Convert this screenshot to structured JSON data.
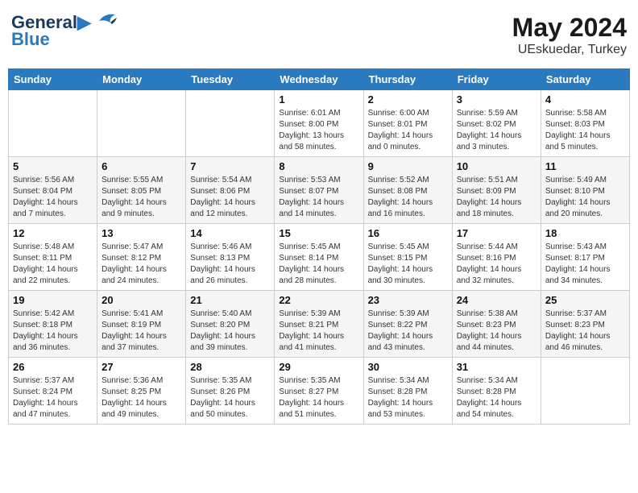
{
  "header": {
    "logo_line1": "General",
    "logo_line2": "Blue",
    "month": "May 2024",
    "location": "UEskuedar, Turkey"
  },
  "weekdays": [
    "Sunday",
    "Monday",
    "Tuesday",
    "Wednesday",
    "Thursday",
    "Friday",
    "Saturday"
  ],
  "weeks": [
    [
      {
        "day": "",
        "info": ""
      },
      {
        "day": "",
        "info": ""
      },
      {
        "day": "",
        "info": ""
      },
      {
        "day": "1",
        "info": "Sunrise: 6:01 AM\nSunset: 8:00 PM\nDaylight: 13 hours\nand 58 minutes."
      },
      {
        "day": "2",
        "info": "Sunrise: 6:00 AM\nSunset: 8:01 PM\nDaylight: 14 hours\nand 0 minutes."
      },
      {
        "day": "3",
        "info": "Sunrise: 5:59 AM\nSunset: 8:02 PM\nDaylight: 14 hours\nand 3 minutes."
      },
      {
        "day": "4",
        "info": "Sunrise: 5:58 AM\nSunset: 8:03 PM\nDaylight: 14 hours\nand 5 minutes."
      }
    ],
    [
      {
        "day": "5",
        "info": "Sunrise: 5:56 AM\nSunset: 8:04 PM\nDaylight: 14 hours\nand 7 minutes."
      },
      {
        "day": "6",
        "info": "Sunrise: 5:55 AM\nSunset: 8:05 PM\nDaylight: 14 hours\nand 9 minutes."
      },
      {
        "day": "7",
        "info": "Sunrise: 5:54 AM\nSunset: 8:06 PM\nDaylight: 14 hours\nand 12 minutes."
      },
      {
        "day": "8",
        "info": "Sunrise: 5:53 AM\nSunset: 8:07 PM\nDaylight: 14 hours\nand 14 minutes."
      },
      {
        "day": "9",
        "info": "Sunrise: 5:52 AM\nSunset: 8:08 PM\nDaylight: 14 hours\nand 16 minutes."
      },
      {
        "day": "10",
        "info": "Sunrise: 5:51 AM\nSunset: 8:09 PM\nDaylight: 14 hours\nand 18 minutes."
      },
      {
        "day": "11",
        "info": "Sunrise: 5:49 AM\nSunset: 8:10 PM\nDaylight: 14 hours\nand 20 minutes."
      }
    ],
    [
      {
        "day": "12",
        "info": "Sunrise: 5:48 AM\nSunset: 8:11 PM\nDaylight: 14 hours\nand 22 minutes."
      },
      {
        "day": "13",
        "info": "Sunrise: 5:47 AM\nSunset: 8:12 PM\nDaylight: 14 hours\nand 24 minutes."
      },
      {
        "day": "14",
        "info": "Sunrise: 5:46 AM\nSunset: 8:13 PM\nDaylight: 14 hours\nand 26 minutes."
      },
      {
        "day": "15",
        "info": "Sunrise: 5:45 AM\nSunset: 8:14 PM\nDaylight: 14 hours\nand 28 minutes."
      },
      {
        "day": "16",
        "info": "Sunrise: 5:45 AM\nSunset: 8:15 PM\nDaylight: 14 hours\nand 30 minutes."
      },
      {
        "day": "17",
        "info": "Sunrise: 5:44 AM\nSunset: 8:16 PM\nDaylight: 14 hours\nand 32 minutes."
      },
      {
        "day": "18",
        "info": "Sunrise: 5:43 AM\nSunset: 8:17 PM\nDaylight: 14 hours\nand 34 minutes."
      }
    ],
    [
      {
        "day": "19",
        "info": "Sunrise: 5:42 AM\nSunset: 8:18 PM\nDaylight: 14 hours\nand 36 minutes."
      },
      {
        "day": "20",
        "info": "Sunrise: 5:41 AM\nSunset: 8:19 PM\nDaylight: 14 hours\nand 37 minutes."
      },
      {
        "day": "21",
        "info": "Sunrise: 5:40 AM\nSunset: 8:20 PM\nDaylight: 14 hours\nand 39 minutes."
      },
      {
        "day": "22",
        "info": "Sunrise: 5:39 AM\nSunset: 8:21 PM\nDaylight: 14 hours\nand 41 minutes."
      },
      {
        "day": "23",
        "info": "Sunrise: 5:39 AM\nSunset: 8:22 PM\nDaylight: 14 hours\nand 43 minutes."
      },
      {
        "day": "24",
        "info": "Sunrise: 5:38 AM\nSunset: 8:23 PM\nDaylight: 14 hours\nand 44 minutes."
      },
      {
        "day": "25",
        "info": "Sunrise: 5:37 AM\nSunset: 8:23 PM\nDaylight: 14 hours\nand 46 minutes."
      }
    ],
    [
      {
        "day": "26",
        "info": "Sunrise: 5:37 AM\nSunset: 8:24 PM\nDaylight: 14 hours\nand 47 minutes."
      },
      {
        "day": "27",
        "info": "Sunrise: 5:36 AM\nSunset: 8:25 PM\nDaylight: 14 hours\nand 49 minutes."
      },
      {
        "day": "28",
        "info": "Sunrise: 5:35 AM\nSunset: 8:26 PM\nDaylight: 14 hours\nand 50 minutes."
      },
      {
        "day": "29",
        "info": "Sunrise: 5:35 AM\nSunset: 8:27 PM\nDaylight: 14 hours\nand 51 minutes."
      },
      {
        "day": "30",
        "info": "Sunrise: 5:34 AM\nSunset: 8:28 PM\nDaylight: 14 hours\nand 53 minutes."
      },
      {
        "day": "31",
        "info": "Sunrise: 5:34 AM\nSunset: 8:28 PM\nDaylight: 14 hours\nand 54 minutes."
      },
      {
        "day": "",
        "info": ""
      }
    ]
  ]
}
